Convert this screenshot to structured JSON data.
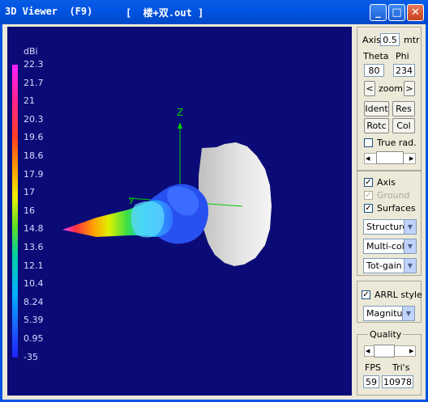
{
  "window": {
    "title": "3D Viewer  (F9)",
    "file_label": "[  楼+双.out ]",
    "btn_minimize": "_",
    "btn_maximize": "□",
    "btn_close": "✕"
  },
  "colors": {
    "title_bar": "#0054e3",
    "view_background": "#0b0b77",
    "axis_z": "#00cc00",
    "reflector": "#dddddd"
  },
  "scale": {
    "unit": "dBi",
    "ticks": [
      "22.3",
      "21.7",
      "21",
      "20.3",
      "19.6",
      "18.6",
      "17.9",
      "17",
      "16",
      "14.8",
      "13.6",
      "12.1",
      "10.4",
      "8.24",
      "5.39",
      "0.95",
      "-35"
    ]
  },
  "axes": {
    "z_label": "Z",
    "y_label": "y"
  },
  "panel": {
    "axis_label": "Axis",
    "axis_value": "0.5",
    "axis_unit": "mtr",
    "theta_label": "Theta",
    "phi_label": "Phi",
    "theta_value": "80",
    "phi_value": "234",
    "zoom_left": "<",
    "zoom_label": "zoom",
    "zoom_right": ">",
    "ident_label": "Ident",
    "res_label": "Res",
    "rotc_label": "Rotc",
    "col_label": "Col",
    "true_rad_label": "True rad.",
    "axis_check_label": "Axis",
    "ground_label": "Ground",
    "surfaces_label": "Surfaces",
    "structure_select": "Structure",
    "color_select": "Multi-colo",
    "gain_select": "Tot-gain",
    "arrl_label": "ARRL style",
    "magnitude_select": "Magnitu",
    "quality_label": "Quality",
    "fps_label": "FPS",
    "tris_label": "Tri's",
    "fps_value": "59",
    "tris_value": "10978"
  }
}
